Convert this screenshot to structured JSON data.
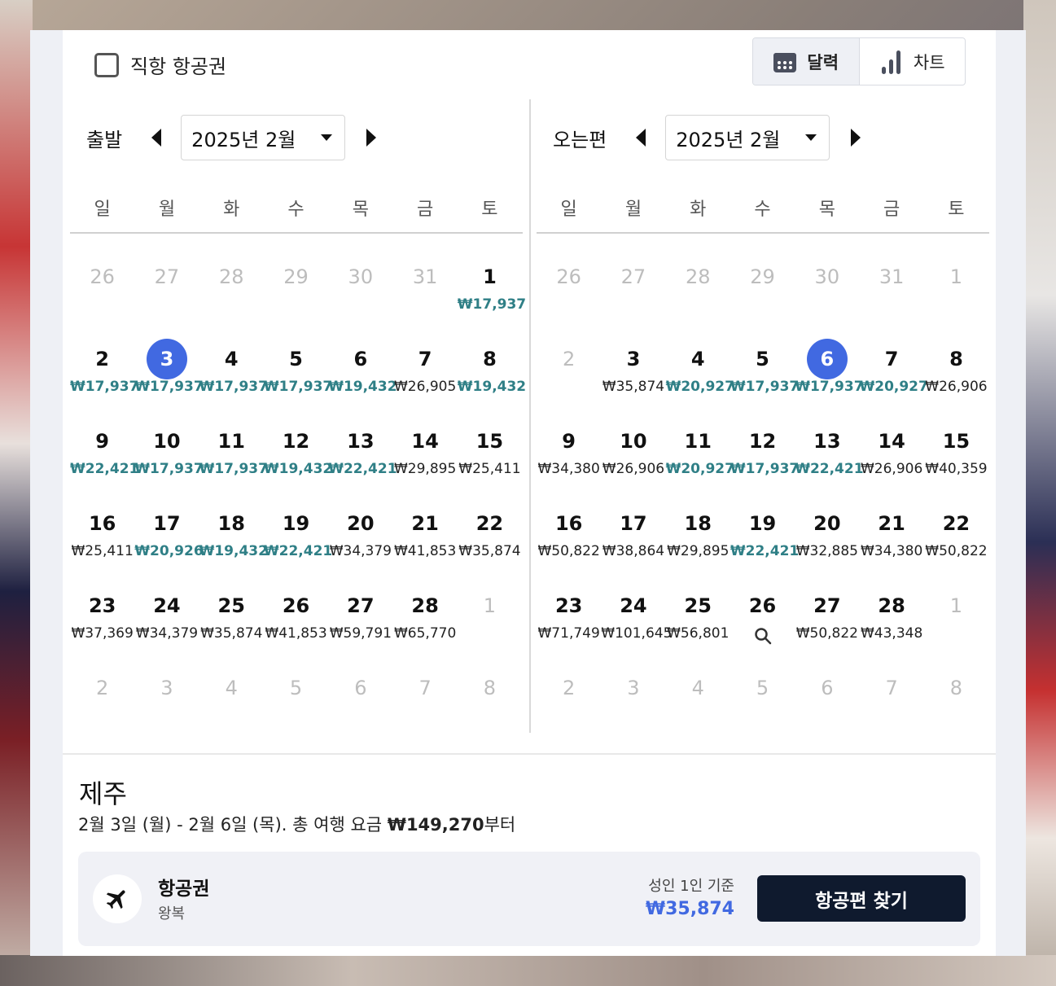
{
  "direct_flight": {
    "label": "직항 항공권",
    "checked": false
  },
  "view_toggle": {
    "calendar_label": "달력",
    "chart_label": "차트",
    "active": "calendar"
  },
  "weekdays": [
    "일",
    "월",
    "화",
    "수",
    "목",
    "금",
    "토"
  ],
  "departure": {
    "label": "출발",
    "month": "2025년 2월",
    "selected_day": "3",
    "weeks": [
      [
        {
          "d": "26",
          "m": true
        },
        {
          "d": "27",
          "m": true
        },
        {
          "d": "28",
          "m": true
        },
        {
          "d": "29",
          "m": true
        },
        {
          "d": "30",
          "m": true
        },
        {
          "d": "31",
          "m": true
        },
        {
          "d": "1",
          "p": "₩17,937",
          "low": true
        }
      ],
      [
        {
          "d": "2",
          "p": "₩17,937",
          "low": true
        },
        {
          "d": "3",
          "p": "₩17,937",
          "low": true,
          "sel": true
        },
        {
          "d": "4",
          "p": "₩17,937",
          "low": true
        },
        {
          "d": "5",
          "p": "₩17,937",
          "low": true
        },
        {
          "d": "6",
          "p": "₩19,432",
          "low": true
        },
        {
          "d": "7",
          "p": "₩26,905"
        },
        {
          "d": "8",
          "p": "₩19,432",
          "low": true
        }
      ],
      [
        {
          "d": "9",
          "p": "₩22,421",
          "low": true
        },
        {
          "d": "10",
          "p": "₩17,937",
          "low": true
        },
        {
          "d": "11",
          "p": "₩17,937",
          "low": true
        },
        {
          "d": "12",
          "p": "₩19,432",
          "low": true
        },
        {
          "d": "13",
          "p": "₩22,421",
          "low": true
        },
        {
          "d": "14",
          "p": "₩29,895"
        },
        {
          "d": "15",
          "p": "₩25,411"
        }
      ],
      [
        {
          "d": "16",
          "p": "₩25,411"
        },
        {
          "d": "17",
          "p": "₩20,926",
          "low": true
        },
        {
          "d": "18",
          "p": "₩19,432",
          "low": true
        },
        {
          "d": "19",
          "p": "₩22,421",
          "low": true
        },
        {
          "d": "20",
          "p": "₩34,379"
        },
        {
          "d": "21",
          "p": "₩41,853"
        },
        {
          "d": "22",
          "p": "₩35,874"
        }
      ],
      [
        {
          "d": "23",
          "p": "₩37,369"
        },
        {
          "d": "24",
          "p": "₩34,379"
        },
        {
          "d": "25",
          "p": "₩35,874"
        },
        {
          "d": "26",
          "p": "₩41,853"
        },
        {
          "d": "27",
          "p": "₩59,791"
        },
        {
          "d": "28",
          "p": "₩65,770"
        },
        {
          "d": "1",
          "m": true
        }
      ],
      [
        {
          "d": "2",
          "m": true
        },
        {
          "d": "3",
          "m": true
        },
        {
          "d": "4",
          "m": true
        },
        {
          "d": "5",
          "m": true
        },
        {
          "d": "6",
          "m": true
        },
        {
          "d": "7",
          "m": true
        },
        {
          "d": "8",
          "m": true
        }
      ]
    ]
  },
  "return": {
    "label": "오는편",
    "month": "2025년 2월",
    "selected_day": "6",
    "weeks": [
      [
        {
          "d": "26",
          "m": true
        },
        {
          "d": "27",
          "m": true
        },
        {
          "d": "28",
          "m": true
        },
        {
          "d": "29",
          "m": true
        },
        {
          "d": "30",
          "m": true
        },
        {
          "d": "31",
          "m": true
        },
        {
          "d": "1",
          "m": true
        }
      ],
      [
        {
          "d": "2",
          "m": true
        },
        {
          "d": "3",
          "p": "₩35,874"
        },
        {
          "d": "4",
          "p": "₩20,927",
          "low": true
        },
        {
          "d": "5",
          "p": "₩17,937",
          "low": true
        },
        {
          "d": "6",
          "p": "₩17,937",
          "low": true,
          "sel": true
        },
        {
          "d": "7",
          "p": "₩20,927",
          "low": true
        },
        {
          "d": "8",
          "p": "₩26,906"
        }
      ],
      [
        {
          "d": "9",
          "p": "₩34,380"
        },
        {
          "d": "10",
          "p": "₩26,906"
        },
        {
          "d": "11",
          "p": "₩20,927",
          "low": true
        },
        {
          "d": "12",
          "p": "₩17,937",
          "low": true
        },
        {
          "d": "13",
          "p": "₩22,421",
          "low": true
        },
        {
          "d": "14",
          "p": "₩26,906"
        },
        {
          "d": "15",
          "p": "₩40,359"
        }
      ],
      [
        {
          "d": "16",
          "p": "₩50,822"
        },
        {
          "d": "17",
          "p": "₩38,864"
        },
        {
          "d": "18",
          "p": "₩29,895"
        },
        {
          "d": "19",
          "p": "₩22,421",
          "low": true
        },
        {
          "d": "20",
          "p": "₩32,885"
        },
        {
          "d": "21",
          "p": "₩34,380"
        },
        {
          "d": "22",
          "p": "₩50,822"
        }
      ],
      [
        {
          "d": "23",
          "p": "₩71,749"
        },
        {
          "d": "24",
          "p": "₩101,645"
        },
        {
          "d": "25",
          "p": "₩56,801"
        },
        {
          "d": "26",
          "search": true
        },
        {
          "d": "27",
          "p": "₩50,822"
        },
        {
          "d": "28",
          "p": "₩43,348"
        },
        {
          "d": "1",
          "m": true
        }
      ],
      [
        {
          "d": "2",
          "m": true
        },
        {
          "d": "3",
          "m": true
        },
        {
          "d": "4",
          "m": true
        },
        {
          "d": "5",
          "m": true
        },
        {
          "d": "6",
          "m": true
        },
        {
          "d": "7",
          "m": true
        },
        {
          "d": "8",
          "m": true
        }
      ]
    ]
  },
  "destination": "제주",
  "summary": {
    "dates": "2월 3일 (월) - 2월 6일 (목).",
    "total_prefix": "총 여행 요금",
    "total": "₩149,270",
    "total_suffix": "부터"
  },
  "flight_card": {
    "title": "항공권",
    "subtitle": "왕복",
    "basis": "성인 1인 기준",
    "price": "₩35,874",
    "button_label": "항공편 찾기"
  },
  "colors": {
    "accent": "#4169e1",
    "low_price": "#2f7f86",
    "button_bg": "#0f1a2e"
  }
}
